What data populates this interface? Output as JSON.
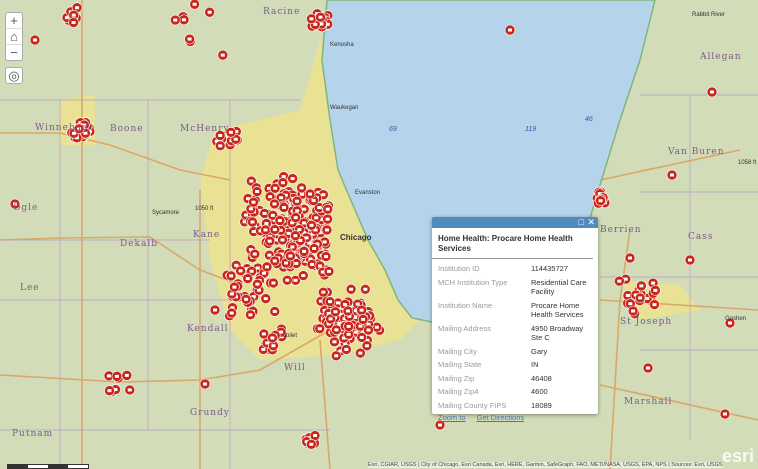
{
  "map": {
    "county_labels": [
      "Winnebago",
      "Boone",
      "McHenry",
      "Ogle",
      "Dekalb",
      "Kane",
      "Lee",
      "Kendall",
      "Will",
      "Grundy",
      "Putnam",
      "Allegan",
      "Van Buren",
      "Berrien",
      "Cass",
      "St Joseph",
      "Marshall"
    ],
    "city_labels": [
      "Racine",
      "Kenosha",
      "Waukegan",
      "Evanston",
      "Chicago",
      "Sycamore",
      "Joliet",
      "Goshen",
      "Rabbit River",
      "1050 ft",
      "1058 ft"
    ],
    "lake_numbers": [
      "69",
      "119",
      "46"
    ],
    "colors": {
      "water": "#b5d3ea",
      "land": "#d3dcb8",
      "urban": "#f0e68a",
      "marker": "#c8261a",
      "popup_header": "#4f8bbd"
    }
  },
  "controls": {
    "zoom_in": "+",
    "zoom_out": "−",
    "home": "⌂",
    "locate": "◎"
  },
  "popup": {
    "title": "Home Health: Procare Home Health Services",
    "fields": [
      {
        "label": "Institution ID",
        "value": "114435727"
      },
      {
        "label": "MCH Institution Type",
        "value": "Residential Care Facility"
      },
      {
        "label": "Institution Name",
        "value": "Procare Home Health Services"
      },
      {
        "label": "Mailing Address",
        "value": "4950 Broadway Ste C"
      },
      {
        "label": "Mailing City",
        "value": "Gary"
      },
      {
        "label": "Mailing State",
        "value": "IN"
      },
      {
        "label": "Mailing Zip",
        "value": "46408"
      },
      {
        "label": "Mailing Zip4",
        "value": "4600"
      },
      {
        "label": "Mailing County FIPS",
        "value": "18089"
      }
    ],
    "zoom_to": "Zoom to",
    "get_directions": "Get Directions",
    "maximize": "□",
    "close": "✕"
  },
  "attribution": "Esri, CGIAR, USGS | City of Chicago, Esri Canada, Esri, HERE, Garmin, SafeGraph, FAO, METI/NASA, USGS, EPA, NPS | Sources: Esri, USGS",
  "logo": "esri"
}
